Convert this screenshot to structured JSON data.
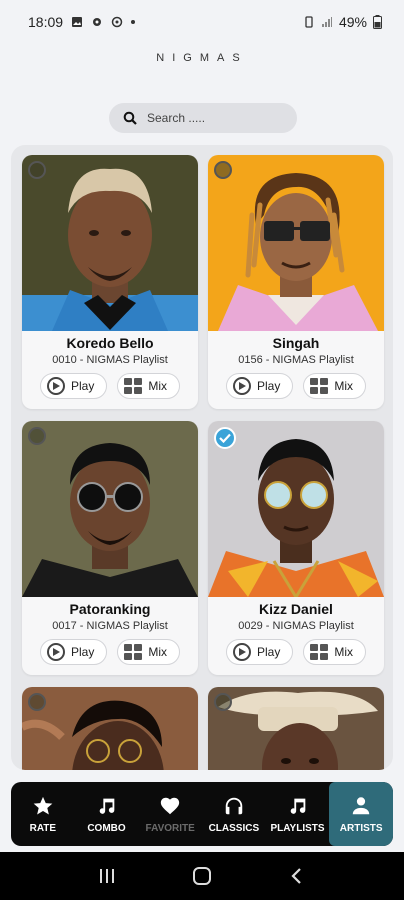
{
  "status": {
    "time": "18:09",
    "battery": "49%"
  },
  "app": {
    "title": "NIGMAS"
  },
  "search": {
    "placeholder": "Search ....."
  },
  "cards": [
    {
      "name": "Koredo Bello",
      "subtitle": "0010 - NIGMAS Playlist",
      "play": "Play",
      "mix": "Mix",
      "selected": false
    },
    {
      "name": "Singah",
      "subtitle": "0156 - NIGMAS Playlist",
      "play": "Play",
      "mix": "Mix",
      "selected": false
    },
    {
      "name": "Patoranking",
      "subtitle": "0017 - NIGMAS Playlist",
      "play": "Play",
      "mix": "Mix",
      "selected": false
    },
    {
      "name": "Kizz Daniel",
      "subtitle": "0029 - NIGMAS Playlist",
      "play": "Play",
      "mix": "Mix",
      "selected": true
    }
  ],
  "nav": [
    {
      "label": "RATE",
      "icon": "star-icon"
    },
    {
      "label": "COMBO",
      "icon": "music-note-icon"
    },
    {
      "label": "FAVORITE",
      "icon": "heart-icon"
    },
    {
      "label": "CLASSICS",
      "icon": "headphones-icon"
    },
    {
      "label": "PLAYLISTS",
      "icon": "music-note-icon"
    },
    {
      "label": "ARTISTS",
      "icon": "person-icon"
    }
  ],
  "colors": {
    "accent": "#2f6b7a",
    "check": "#3aa3d8",
    "nav_bg": "#0b0b0b"
  }
}
